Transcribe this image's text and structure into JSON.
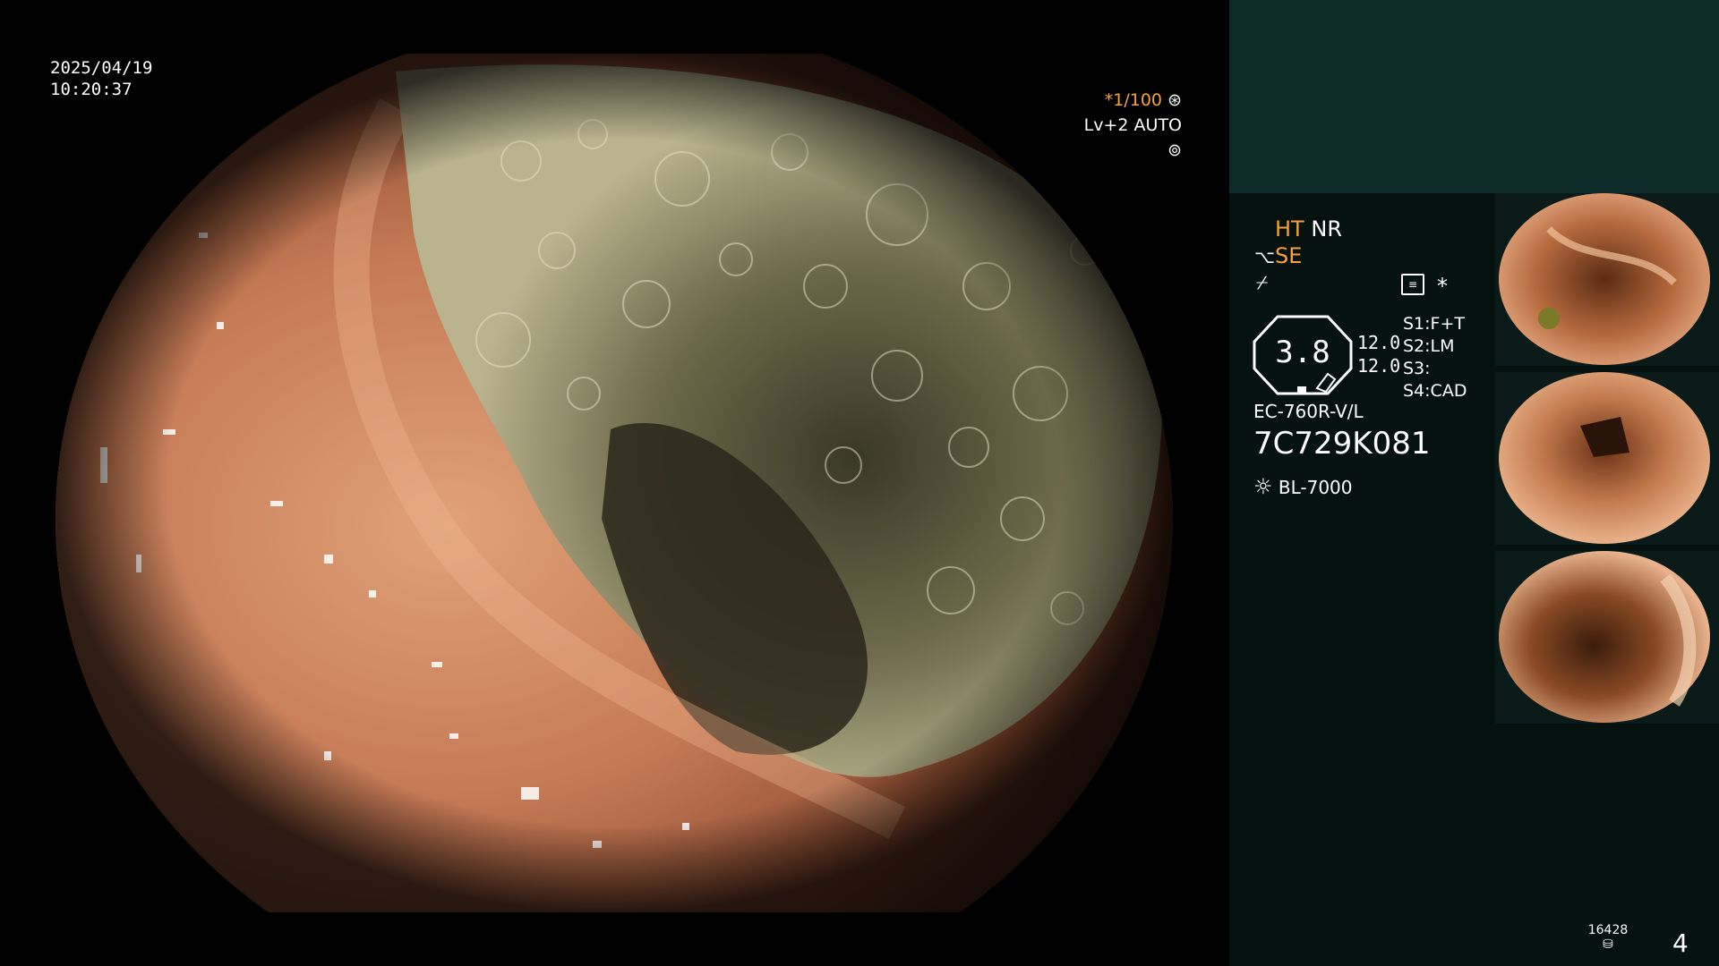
{
  "overlay": {
    "date": "2025/04/19",
    "time": "10:20:37",
    "shutter": "*1/100",
    "level": "Lv+2 AUTO"
  },
  "panel": {
    "ht": "HT",
    "nr": "NR",
    "se": "SE",
    "scope_value": "3.8",
    "val_a": "12.0",
    "val_b": "12.0",
    "s1": "S1:F+T",
    "s2": "S2:LM",
    "s3": "S3:",
    "s4": "S4:CAD",
    "asterisk": "*",
    "model": "EC-760R-V/L",
    "serial": "7C729K081",
    "light_source": "BL-7000",
    "counter": "16428",
    "page_number": "4"
  },
  "colors": {
    "accent_orange": "#f5a23a",
    "panel_bg": "#061210",
    "panel_top_bg": "#0d2a29"
  },
  "icons": [
    "shutter-icon",
    "auto-iris-icon",
    "se-icon",
    "scope-mode-icon",
    "menu-icon",
    "light-source-icon",
    "storage-icon"
  ]
}
